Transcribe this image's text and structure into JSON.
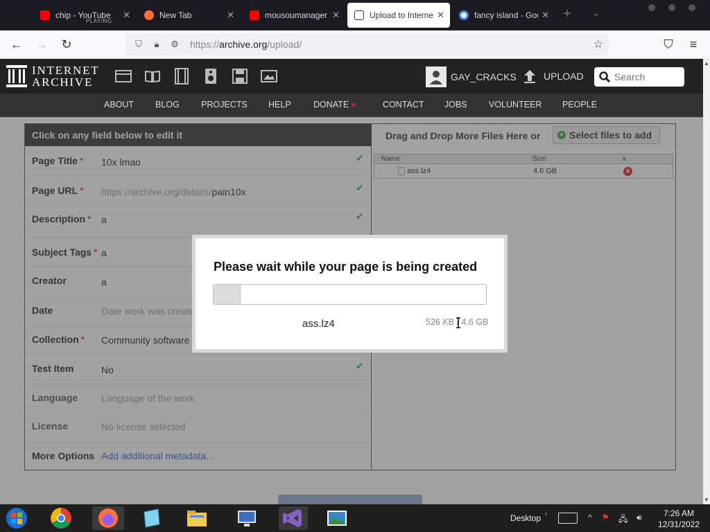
{
  "browser": {
    "tabs": [
      {
        "title": "chip - YouTube",
        "subtitle": "PLAYING",
        "icon": "youtube-icon",
        "active": false
      },
      {
        "title": "New Tab",
        "icon": "firefox-icon",
        "active": false
      },
      {
        "title": "mousoumanager - ",
        "icon": "youtube-icon",
        "active": false
      },
      {
        "title": "Upload to Interne",
        "icon": "archive-icon",
        "active": true
      },
      {
        "title": "fancy island - Goo",
        "icon": "google-icon",
        "active": false
      }
    ],
    "new_tab_symbol": "+",
    "url_prefix": "https://",
    "url_host": "archive.org",
    "url_path": "/upload/"
  },
  "site": {
    "logo_line1": "INTERNET",
    "logo_line2": "ARCHIVE",
    "username": "GAY_CRACKS",
    "upload_label": "UPLOAD",
    "search_placeholder": "Search",
    "nav": [
      "ABOUT",
      "BLOG",
      "PROJECTS",
      "HELP",
      "DONATE",
      "CONTACT",
      "JOBS",
      "VOLUNTEER",
      "PEOPLE"
    ],
    "donate_heart": "♥"
  },
  "form": {
    "header": "Click on any field below to edit it",
    "fields": [
      {
        "label": "Page Title",
        "required": true,
        "value": "10x lmao",
        "placeholder": false,
        "check": true
      },
      {
        "label": "Page URL",
        "required": true,
        "value_prefix": "https://archive.org/details/",
        "value": "pain10x",
        "placeholder": false,
        "check": true
      },
      {
        "label": "Description",
        "required": true,
        "value": "a",
        "placeholder": false,
        "check": true
      },
      {
        "label": "Subject Tags",
        "required": true,
        "value": "a",
        "placeholder": false,
        "check": false
      },
      {
        "label": "Creator",
        "required": false,
        "value": "a",
        "placeholder": false,
        "check": false
      },
      {
        "label": "Date",
        "required": false,
        "value": "Date work was create",
        "placeholder": true,
        "check": false
      },
      {
        "label": "Collection",
        "required": true,
        "value": "Community software",
        "placeholder": false,
        "check": false
      },
      {
        "label": "Test Item",
        "required": false,
        "value": "No",
        "placeholder": false,
        "check": true
      },
      {
        "label": "Language",
        "required": false,
        "value": "Language of the work",
        "placeholder": true,
        "check": false
      },
      {
        "label": "License",
        "required": false,
        "value": "No license selected",
        "placeholder": true,
        "check": false
      },
      {
        "label": "More Options",
        "required": false,
        "value": "Add additional metadata...",
        "link": true,
        "check": false
      }
    ],
    "required_mark": "*",
    "check_mark": "✔"
  },
  "files": {
    "drag_text": "Drag and Drop More Files Here or",
    "select_button": "Select files to add",
    "columns": [
      "Name",
      "Size",
      "x"
    ],
    "rows": [
      {
        "name": "ass.lz4",
        "size": "4.6 GB"
      }
    ]
  },
  "modal": {
    "title": "Please wait while your page is being created",
    "file_name": "ass.lz4",
    "size_text": "526 KB / 4.6 GB",
    "progress_fraction": 0.1
  },
  "taskbar": {
    "desktop_label": "Desktop",
    "time": "7:26 AM",
    "date": "12/31/2022"
  },
  "colors": {
    "header_bg": "#222222",
    "subnav_bg": "#333333",
    "check_green": "#33a344",
    "required_red": "#dd0000"
  }
}
